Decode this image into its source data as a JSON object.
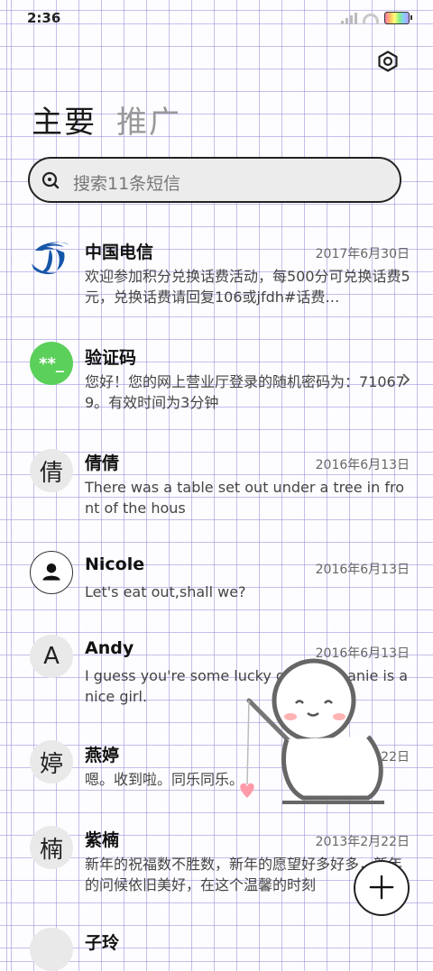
{
  "status_bar": {
    "time": "2:36"
  },
  "tabs": [
    {
      "label": "主要"
    },
    {
      "label": "推广"
    }
  ],
  "search": {
    "placeholder": "搜索11条短信"
  },
  "conversations": [
    {
      "name": "中国电信",
      "date": "2017年6月30日",
      "preview": "欢迎参加积分兑换话费活动，每500分可兑换话费5元，兑换话费请回复106或jfdh#话费…",
      "avatar": "china-telecom-logo"
    },
    {
      "name": "验证码",
      "date": "",
      "preview": "您好！您的网上营业厅登录的随机密码为：710679。有效时间为3分钟",
      "avatar_text": "**_"
    },
    {
      "name": "倩倩",
      "date": "2016年6月13日",
      "preview": "There was a table set out under a tree in front of the hous",
      "avatar_text": "倩"
    },
    {
      "name": "Nicole",
      "date": "2016年6月13日",
      "preview": "Let's eat out,shall we?",
      "avatar": "person-icon"
    },
    {
      "name": "Andy",
      "date": "2016年6月13日",
      "preview": "I guess you're some lucky guy.Stephanie is a nice girl.",
      "avatar_text": "A"
    },
    {
      "name": "燕婷",
      "date": "2013年2月22日",
      "preview": "嗯。收到啦。同乐同乐。",
      "avatar_text": "婷"
    },
    {
      "name": "紫楠",
      "date": "2013年2月22日",
      "preview": "新年的祝福数不胜数，新年的愿望好多好多，新年的问候依旧美好，在这个温馨的时刻",
      "avatar_text": "楠"
    },
    {
      "name": "子玲",
      "date": "",
      "preview": "",
      "avatar_text": ""
    }
  ],
  "colors": {
    "accent_green": "#5bd05b",
    "telecom_blue": "#1656a8",
    "grid": "#968cdc"
  }
}
